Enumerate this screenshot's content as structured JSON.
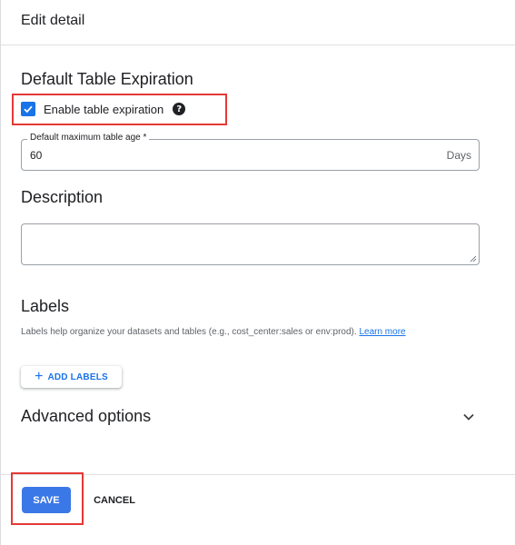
{
  "header": {
    "title": "Edit detail"
  },
  "expiration": {
    "section_title": "Default Table Expiration",
    "checkbox_label": "Enable table expiration",
    "checkbox_checked": true,
    "help_icon": "help-circle-icon",
    "field_label": "Default maximum table age *",
    "field_value": "60",
    "field_suffix": "Days"
  },
  "description": {
    "section_title": "Description",
    "value": ""
  },
  "labels": {
    "section_title": "Labels",
    "help_text": "Labels help organize your datasets and tables (e.g., cost_center:sales or env:prod).",
    "learn_more": "Learn more",
    "add_button": "ADD LABELS"
  },
  "advanced": {
    "title": "Advanced options",
    "icon": "chevron-down-icon"
  },
  "footer": {
    "save_label": "SAVE",
    "cancel_label": "CANCEL"
  },
  "colors": {
    "accent": "#1a73e8",
    "save_button": "#3b78e7",
    "highlight": "#e53935"
  }
}
